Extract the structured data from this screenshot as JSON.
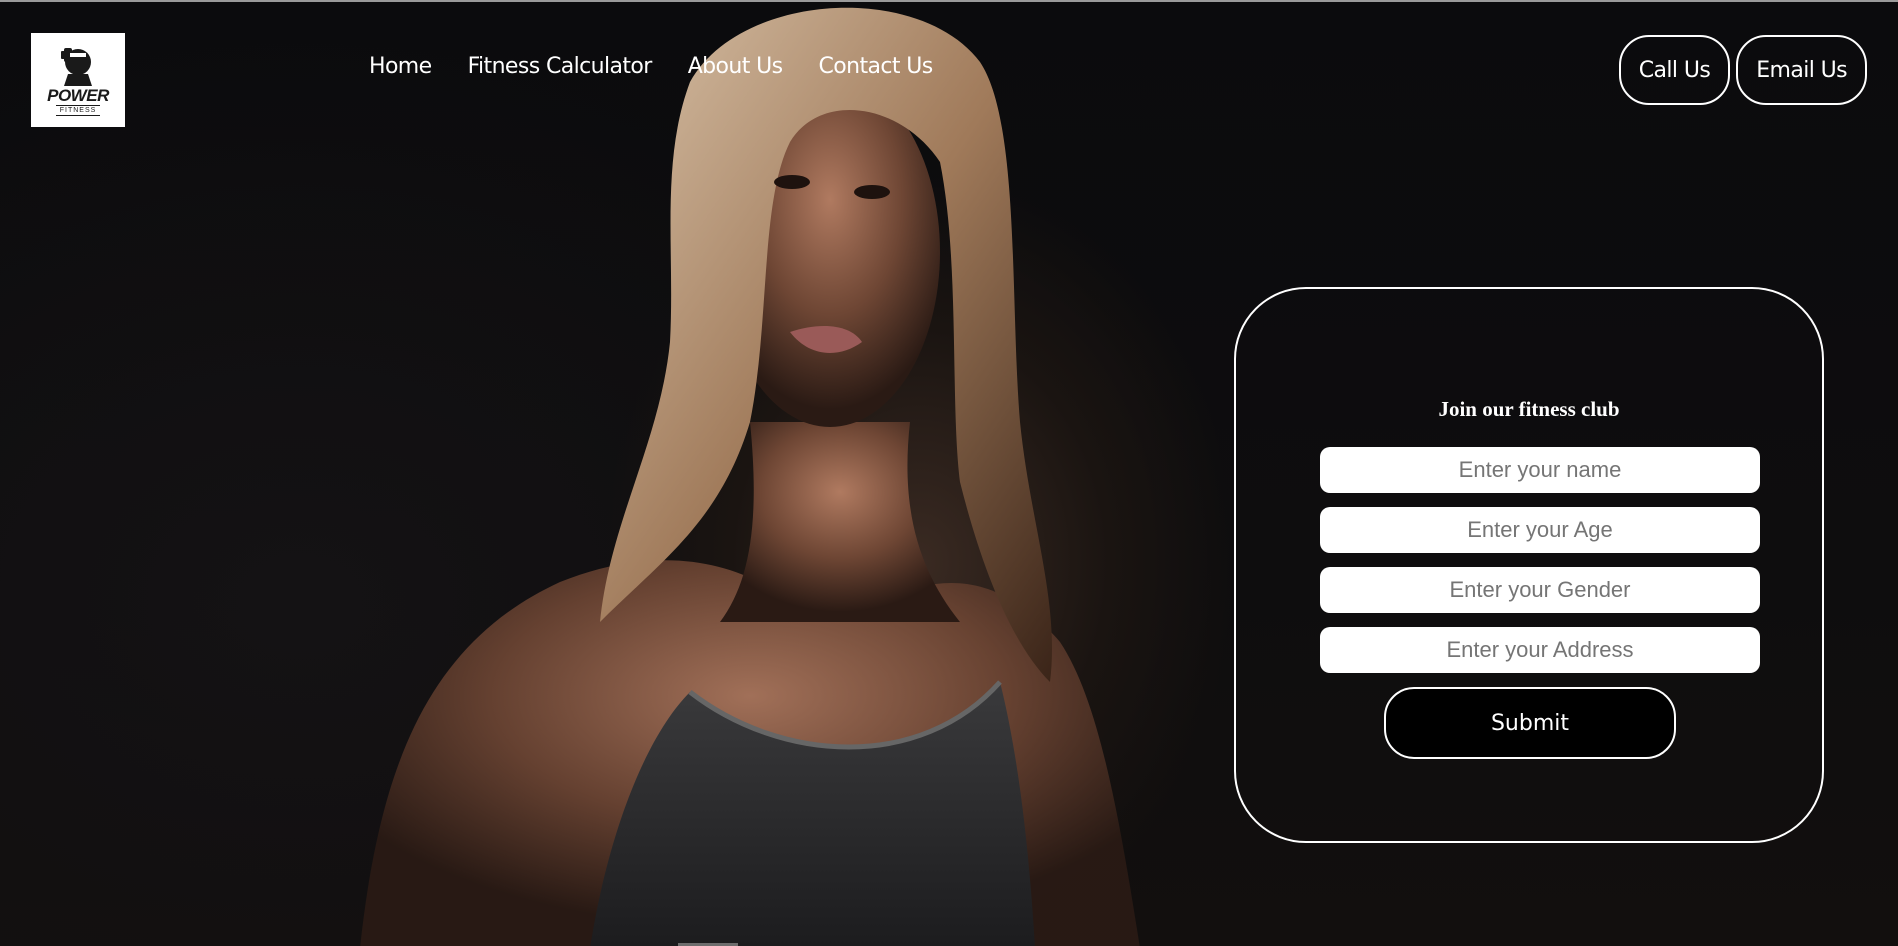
{
  "logo": {
    "text": "POWER",
    "subtext": "FITNESS"
  },
  "nav": {
    "items": [
      {
        "label": "Home"
      },
      {
        "label": "Fitness Calculator"
      },
      {
        "label": "About Us"
      },
      {
        "label": "Contact Us"
      }
    ]
  },
  "header_buttons": {
    "call": "Call Us",
    "email": "Email Us"
  },
  "join_form": {
    "title": "Join our fitness club",
    "name_placeholder": "Enter your name",
    "age_placeholder": "Enter your Age",
    "gender_placeholder": "Enter your Gender",
    "address_placeholder": "Enter your Address",
    "submit_label": "Submit"
  },
  "colors": {
    "background": "#0c0c0e",
    "text": "#ffffff",
    "field_bg": "#ffffff",
    "submit_bg": "#000000"
  },
  "icons": {
    "logo": "dumbbell-icon"
  }
}
